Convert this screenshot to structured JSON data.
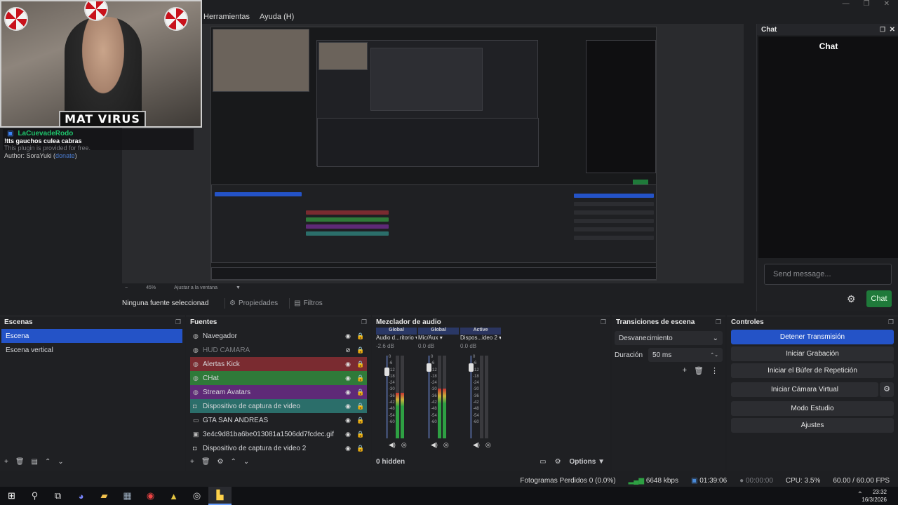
{
  "menu": {
    "items": [
      "Herramientas",
      "Ayuda (H)"
    ]
  },
  "overlay": {
    "nameplate": "MAT VIRUS",
    "chat_user": "LaCuevadeRodo",
    "chat_message": "!tts gauchos culea cabras",
    "plugin_note": "This plugin is provided for free.",
    "author_prefix": "Author: SoraYuki (",
    "author_link": "donate",
    "author_suffix": ")"
  },
  "preview": {
    "zoom": "45%",
    "zoom_mode": "Ajustar a la ventana"
  },
  "source_bar": {
    "selected": "Ninguna fuente seleccionad",
    "properties": "Propiedades",
    "filters": "Filtros"
  },
  "chat_dock": {
    "dock_title": "Chat",
    "title": "Chat",
    "placeholder": "Send message...",
    "send_label": "Chat"
  },
  "scenes": {
    "title": "Escenas",
    "items": [
      "Escena",
      "Escena vertical"
    ],
    "selected_index": 0
  },
  "sources": {
    "title": "Fuentes",
    "items": [
      {
        "name": "Navegador",
        "color": "",
        "icon": "globe-icon",
        "visible": true
      },
      {
        "name": "HUD CAMARA",
        "color": "",
        "icon": "globe-icon",
        "visible": false
      },
      {
        "name": "Alertas Kick",
        "color": "#7a2b30",
        "icon": "globe-icon",
        "visible": true
      },
      {
        "name": "CHat",
        "color": "#2f7a39",
        "icon": "globe-icon",
        "visible": true
      },
      {
        "name": "Stream Avatars",
        "color": "#5e2a77",
        "icon": "globe-icon",
        "visible": true
      },
      {
        "name": "Dispositivo de captura de video",
        "color": "#2b6e6a",
        "icon": "camera-icon",
        "visible": true
      },
      {
        "name": "GTA SAN ANDREAS",
        "color": "",
        "icon": "monitor-icon",
        "visible": true
      },
      {
        "name": "3e4c9d81ba6be013081a1506dd7fcdec.gif",
        "color": "",
        "icon": "image-icon",
        "visible": true
      },
      {
        "name": "Dispositivo de captura de video 2",
        "color": "",
        "icon": "camera-icon",
        "visible": true
      }
    ]
  },
  "mixer": {
    "title": "Mezclador de audio",
    "channels": [
      {
        "tag": "Global",
        "name": "Audio d...ritorio",
        "db": "-2.6 dB",
        "level": 0.55,
        "fader": 0.85
      },
      {
        "tag": "Global",
        "name": "Mic/Aux",
        "db": "0.0 dB",
        "level": 0.6,
        "fader": 0.9
      },
      {
        "tag": "Active",
        "name": "Dispos...ideo 2",
        "db": "0.0 dB",
        "level": 0.0,
        "fader": 0.9
      }
    ],
    "scale": [
      "0",
      "-6",
      "-12",
      "-18",
      "-24",
      "-30",
      "-36",
      "-42",
      "-48",
      "-54",
      "-60"
    ],
    "hidden": "0 hidden",
    "options": "Options"
  },
  "transitions": {
    "title": "Transiciones de escena",
    "selected": "Desvanecimiento",
    "duration_label": "Duración",
    "duration_value": "50 ms"
  },
  "controls": {
    "title": "Controles",
    "buttons": [
      "Detener Transmisión",
      "Iniciar Grabación",
      "Iniciar el Búfer de Repetición",
      "Iniciar Cámara Virtual",
      "Modo Estudio",
      "Ajustes"
    ]
  },
  "status": {
    "dropped": "Fotogramas Perdidos 0 (0.0%)",
    "bitrate": "6648 kbps",
    "live_time": "01:39:06",
    "rec_time": "00:00:00",
    "cpu": "CPU: 3.5%",
    "fps": "60.00 / 60.00 FPS"
  },
  "taskbar": {
    "time": "23:32",
    "date": "16/3/2026"
  }
}
